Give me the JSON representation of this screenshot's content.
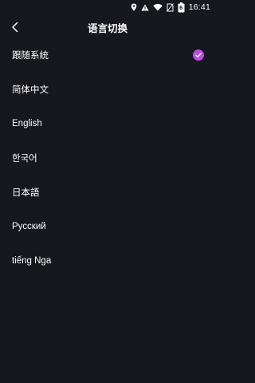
{
  "status_bar": {
    "time": "16:41",
    "battery": "6",
    "icons": [
      "location-icon",
      "warning-icon",
      "wifi-icon",
      "no-sim-icon",
      "battery-icon"
    ]
  },
  "header": {
    "title": "语言切换",
    "back_icon": "chevron-left-icon"
  },
  "languages": [
    {
      "label": "跟随系统",
      "selected": true
    },
    {
      "label": "简体中文",
      "selected": false
    },
    {
      "label": "English",
      "selected": false
    },
    {
      "label": "한국어",
      "selected": false
    },
    {
      "label": "日本語",
      "selected": false
    },
    {
      "label": "Русский",
      "selected": false
    },
    {
      "label": "tiếng Nga",
      "selected": false
    }
  ],
  "colors": {
    "background": "#17171e",
    "accent": "#b84de8",
    "text": "#ffffff"
  }
}
